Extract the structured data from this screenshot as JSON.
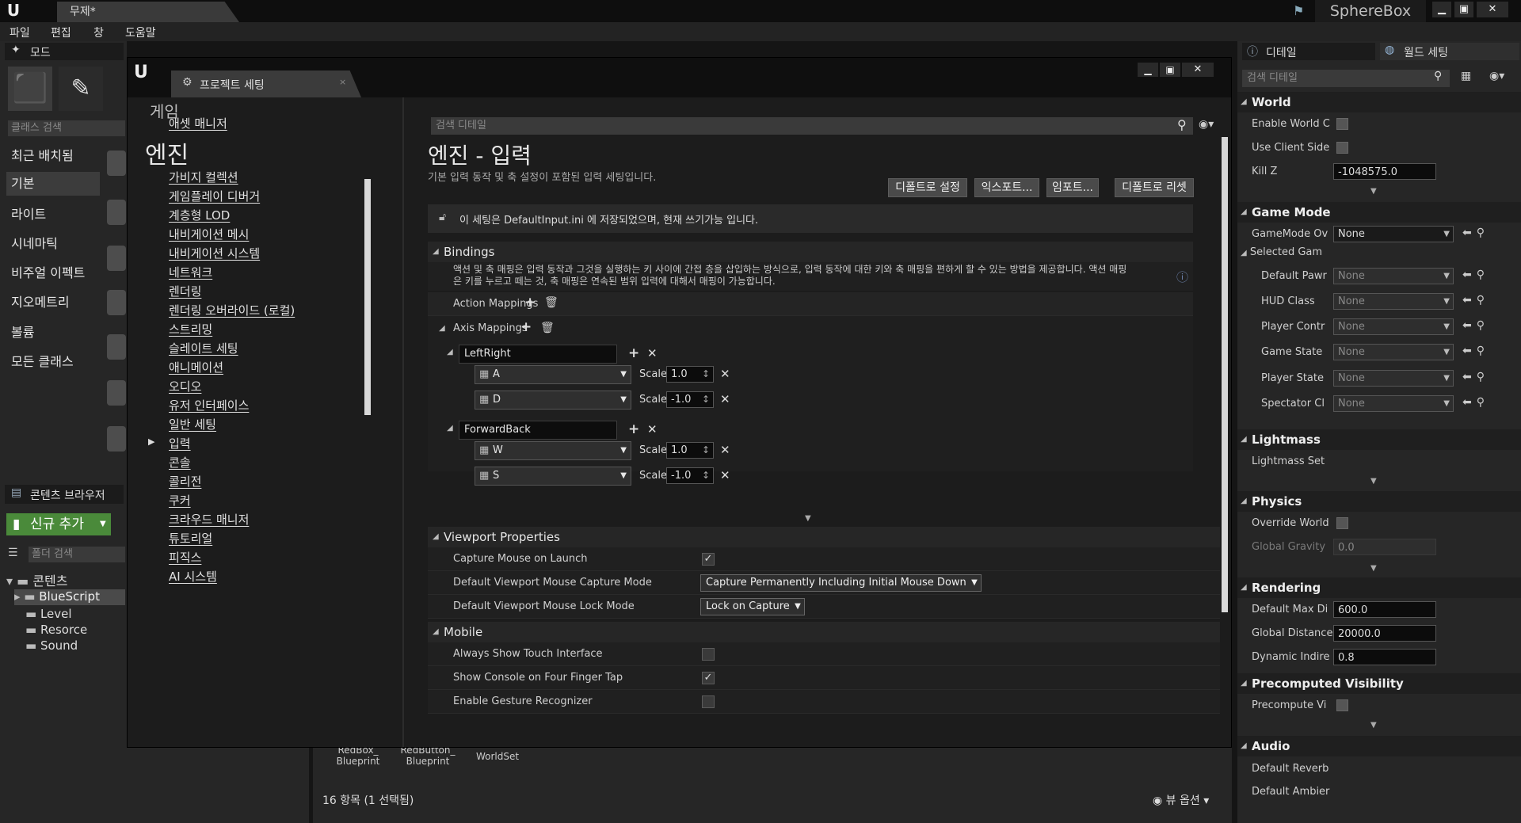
{
  "app": {
    "logo": "U",
    "doc_tab": "무제*",
    "project_name": "SphereBox",
    "menu": [
      "파일",
      "편집",
      "창",
      "도움말"
    ]
  },
  "modes": {
    "tab_label": "모드",
    "search_placeholder": "클래스 검색",
    "categories": [
      "최근 배치됨",
      "기본",
      "라이트",
      "시네마틱",
      "비주얼 이펙트",
      "지오메트리",
      "볼륨",
      "모든 클래스"
    ]
  },
  "content_browser": {
    "tab_label": "콘텐츠 브라우저",
    "add_new": "신규 추가",
    "folder_search_placeholder": "폴더 검색",
    "tree": [
      "콘텐츠",
      "BlueScript",
      "Level",
      "Resorce",
      "Sound"
    ],
    "files": [
      "RedBox_\nBlueprint",
      "RedButton_\nBlueprint",
      "WorldSet"
    ],
    "status": "16 항목 (1 선택됨)",
    "view_options": "뷰 옵션"
  },
  "settings_window": {
    "tab_label": "프로젝트 세팅",
    "nav_header": "엔진",
    "nav_partial_top": "게임",
    "nav_items_top": [
      "애셋 매니저"
    ],
    "nav_items": [
      "가비지 컬렉션",
      "게임플레이 디버거",
      "계층형 LOD",
      "내비게이션 메시",
      "내비게이션 시스템",
      "네트워크",
      "렌더링",
      "렌더링 오버라이드 (로컬)",
      "스트리밍",
      "슬레이트 세팅",
      "애니메이션",
      "오디오",
      "유저 인터페이스",
      "일반 세팅",
      "입력",
      "콘솔",
      "콜리전",
      "쿠커",
      "크라우드 매니저",
      "튜토리얼",
      "피직스",
      "AI 시스템"
    ],
    "search_placeholder": "검색 디테일",
    "page_title": "엔진 - 입력",
    "page_desc": "기본 입력 동작 및 축 설정이 포함된 입력 세팅입니다.",
    "buttons": [
      "디폴트로 설정",
      "익스포트...",
      "임포트...",
      "디폴트로 리셋"
    ],
    "info": "이 세팅은 DefaultInput.ini 에 저장되었으며, 현재 쓰기가능 입니다.",
    "bindings": {
      "title": "Bindings",
      "desc": "액션 및 축 매핑은 입력 동작과 그것을 실행하는 키 사이에 간접 층을 삽입하는 방식으로, 입력 동작에 대한 키와 축 매핑을 편하게 할 수 있는 방법을 제공합니다. 액션 매핑은 키를 누르고 떼는 것, 축 매핑은 연속된 범위 입력에 대해서 매핑이 가능합니다.",
      "action_mappings": "Action Mappings",
      "axis_mappings": "Axis Mappings",
      "scale_label": "Scale",
      "axes": [
        {
          "name": "LeftRight",
          "keys": [
            {
              "key": "A",
              "scale": "1.0"
            },
            {
              "key": "D",
              "scale": "-1.0"
            }
          ]
        },
        {
          "name": "ForwardBack",
          "keys": [
            {
              "key": "W",
              "scale": "1.0"
            },
            {
              "key": "S",
              "scale": "-1.0"
            }
          ]
        }
      ]
    },
    "viewport": {
      "title": "Viewport Properties",
      "rows": [
        {
          "label": "Capture Mouse on Launch",
          "checked": true
        },
        {
          "label": "Default Viewport Mouse Capture Mode",
          "value": "Capture Permanently Including Initial Mouse Down"
        },
        {
          "label": "Default Viewport Mouse Lock Mode",
          "value": "Lock on Capture"
        }
      ]
    },
    "mobile": {
      "title": "Mobile",
      "rows": [
        {
          "label": "Always Show Touch Interface",
          "checked": false
        },
        {
          "label": "Show Console on Four Finger Tap",
          "checked": true
        },
        {
          "label": "Enable Gesture Recognizer",
          "checked": false
        }
      ]
    }
  },
  "details": {
    "tabs": [
      "디테일",
      "월드 세팅"
    ],
    "search_placeholder": "검색 디테일",
    "sections": {
      "world": "World",
      "game_mode": "Game Mode",
      "selected_game": "Selected Gam",
      "lightmass": "Lightmass",
      "physics": "Physics",
      "rendering": "Rendering",
      "precomputed": "Precomputed Visibility",
      "audio": "Audio"
    },
    "world_rows": {
      "enable_world": "Enable World C",
      "use_client": "Use Client Side",
      "kill_z": "Kill Z",
      "kill_z_value": "-1048575.0"
    },
    "game_mode_row": {
      "label": "GameMode Ov",
      "value": "None"
    },
    "selected_rows": [
      {
        "label": "Default Pawr",
        "value": "None"
      },
      {
        "label": "HUD Class",
        "value": "None"
      },
      {
        "label": "Player Contr",
        "value": "None"
      },
      {
        "label": "Game State",
        "value": "None"
      },
      {
        "label": "Player State",
        "value": "None"
      },
      {
        "label": "Spectator Cl",
        "value": "None"
      }
    ],
    "lightmass_row": "Lightmass Set",
    "physics_rows": {
      "override": "Override World",
      "gravity": "Global Gravity",
      "gravity_value": "0.0"
    },
    "rendering_rows": [
      {
        "label": "Default Max Di",
        "value": "600.0"
      },
      {
        "label": "Global Distance",
        "value": "20000.0"
      },
      {
        "label": "Dynamic Indire",
        "value": "0.8"
      }
    ],
    "precomputed_row": "Precompute Vi",
    "audio_rows": [
      "Default Reverb",
      "Default Ambier"
    ]
  }
}
